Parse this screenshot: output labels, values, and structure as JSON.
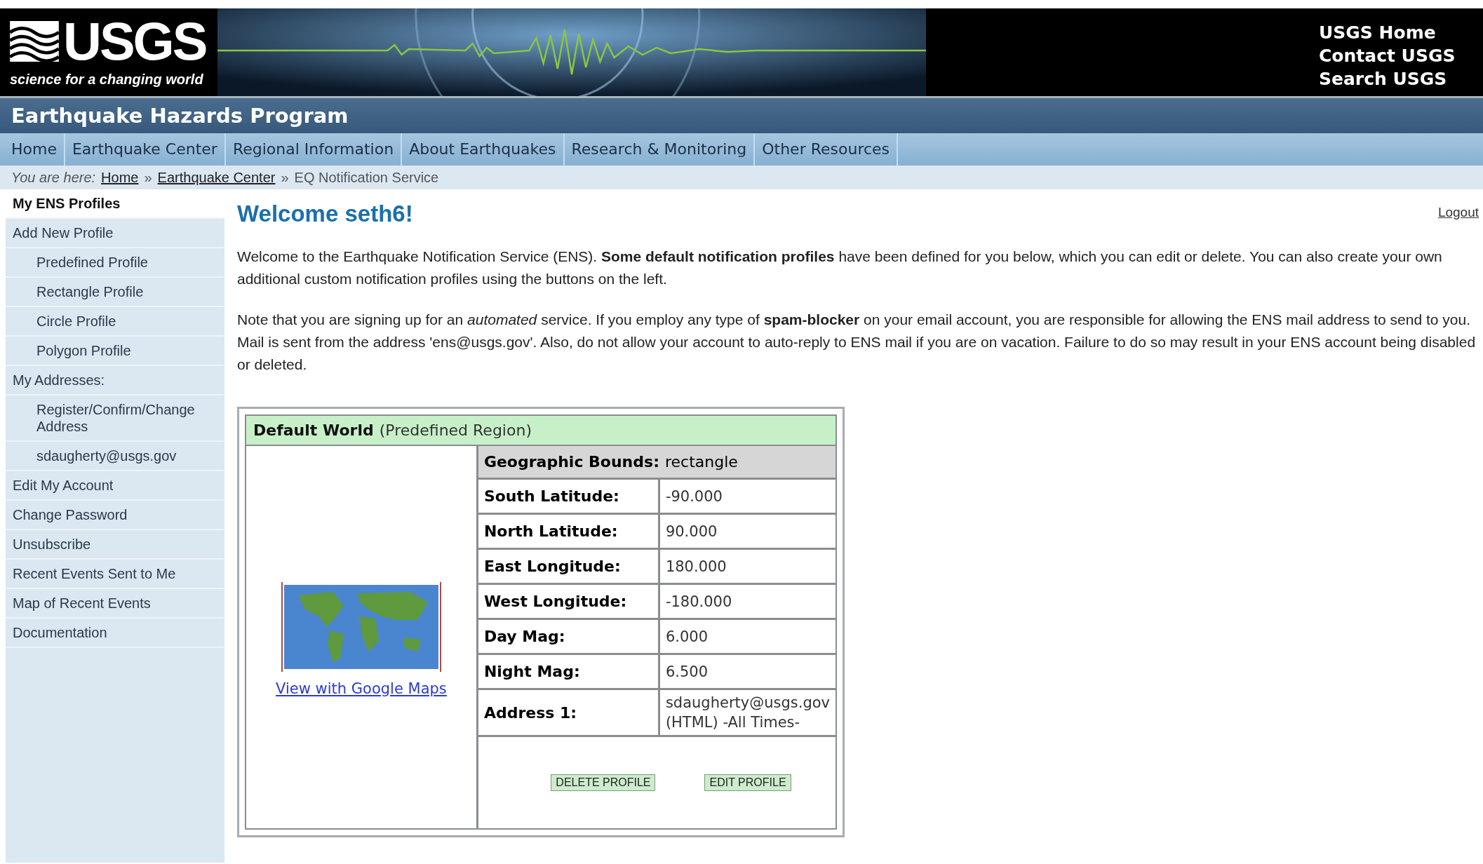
{
  "header": {
    "logo_text": "USGS",
    "tagline": "science for a changing world",
    "links": [
      "USGS Home",
      "Contact USGS",
      "Search USGS"
    ]
  },
  "program_title": "Earthquake Hazards Program",
  "nav": [
    "Home",
    "Earthquake Center",
    "Regional Information",
    "About Earthquakes",
    "Research & Monitoring",
    "Other Resources"
  ],
  "breadcrumb": {
    "prefix": "You are here:",
    "links": [
      "Home",
      "Earthquake Center"
    ],
    "separator": "»",
    "current": "EQ Notification Service"
  },
  "sidebar": {
    "items": [
      {
        "label": "My ENS Profiles",
        "selected": true
      },
      {
        "label": "Add New Profile",
        "selected": false,
        "children": [
          {
            "label": "Predefined Profile",
            "selected": false
          },
          {
            "label": "Rectangle Profile",
            "selected": false
          },
          {
            "label": "Circle Profile",
            "selected": false
          },
          {
            "label": "Polygon Profile",
            "selected": false
          }
        ]
      },
      {
        "label": "My Addresses:",
        "selected": false,
        "children": [
          {
            "label": "Register/Confirm/Change Address",
            "selected": false
          },
          {
            "label": "sdaugherty@usgs.gov",
            "selected": false
          }
        ]
      },
      {
        "label": "Edit My Account",
        "selected": false
      },
      {
        "label": "Change Password",
        "selected": false
      },
      {
        "label": "Unsubscribe",
        "selected": false
      },
      {
        "label": "Recent Events Sent to Me",
        "selected": false
      },
      {
        "label": "Map of Recent Events",
        "selected": false
      },
      {
        "label": "Documentation",
        "selected": false
      }
    ]
  },
  "welcome": "Welcome seth6!",
  "logout": "Logout",
  "paragraphs": [
    "Welcome to the Earthquake Notification Service (ENS). **Some default notification profiles** have been defined for you below, which you can edit or delete. You can also create your own additional custom notification profiles using the buttons on the left.",
    "Note that you are signing up for an *automated* service. If you employ any type of **spam-blocker** on your email account, you are responsible for allowing the ENS mail address to send to you. Mail is sent from the address 'ens@usgs.gov'. Also, do not allow your account to auto-reply to ENS mail if you are on vacation. Failure to do so may result in your ENS account being disabled or deleted."
  ],
  "profile": {
    "name": "Default World",
    "type": "(Predefined Region)",
    "map_link": "View with Google Maps",
    "bounds_label": "Geographic Bounds:",
    "bounds_value": "rectangle",
    "rows": [
      {
        "label": "South Latitude:",
        "value": "-90.000"
      },
      {
        "label": "North Latitude:",
        "value": "90.000"
      },
      {
        "label": "East Longitude:",
        "value": "180.000"
      },
      {
        "label": "West Longitude:",
        "value": "-180.000"
      },
      {
        "label": "Day Mag:",
        "value": "6.000"
      },
      {
        "label": "Night Mag:",
        "value": "6.500"
      },
      {
        "label": "Address 1:",
        "value": "sdaugherty@usgs.gov (HTML) -All Times-"
      }
    ],
    "buttons": [
      "DELETE PROFILE",
      "EDIT PROFILE"
    ]
  }
}
